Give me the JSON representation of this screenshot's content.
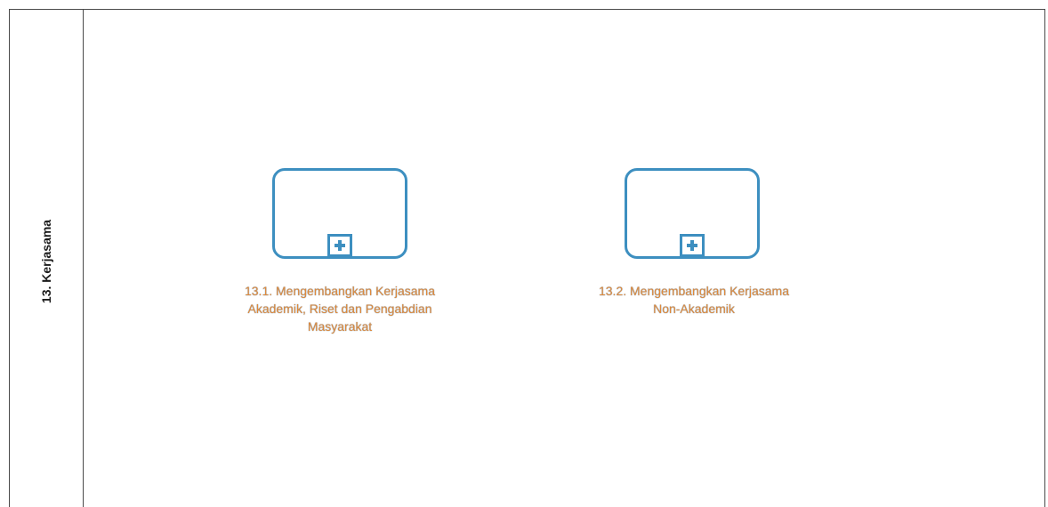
{
  "lane": {
    "title": "13. Kerjasama"
  },
  "subprocesses": [
    {
      "label_line1": "13.1. Mengembangkan Kerjasama",
      "label_line2": "Akademik, Riset dan Pengabdian",
      "label_line3": "Masyarakat",
      "marker_icon": "collapsed-subprocess-plus-icon"
    },
    {
      "label_line1": "13.2. Mengembangkan Kerjasama",
      "label_line2": "Non-Akademik",
      "marker_icon": "collapsed-subprocess-plus-icon"
    }
  ],
  "colors": {
    "subprocess_border": "#3d8fc0",
    "label_text": "#e08a3a",
    "lane_border": "#4a4a4a"
  }
}
